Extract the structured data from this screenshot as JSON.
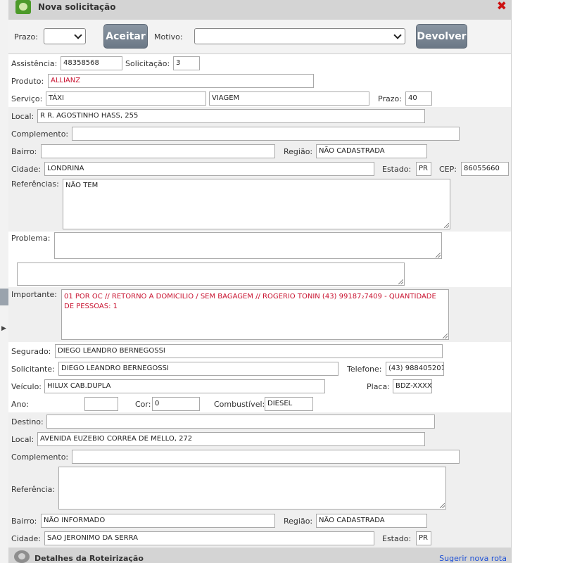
{
  "window": {
    "title": "Nova solicitação"
  },
  "toolbar": {
    "prazo_label": "Prazo:",
    "prazo_value": "",
    "accept_label": "Aceitar",
    "motivo_label": "Motivo:",
    "motivo_value": "",
    "return_label": "Devolver"
  },
  "form": {
    "assistencia_label": "Assistência:",
    "assistencia_value": "48358568",
    "solicitacao_label": "Solicitação:",
    "solicitacao_value": "3",
    "produto_label": "Produto:",
    "produto_value": "ALLIANZ",
    "servico_label": "Serviço:",
    "servico_value": "TÁXI",
    "servico_tipo_value": "VIAGEM",
    "prazo_label": "Prazo:",
    "prazo_value": "40",
    "local_label": "Local:",
    "local_value": "R R. AGOSTINHO HASS, 255",
    "complemento_label": "Complemento:",
    "complemento_value": "",
    "bairro_label": "Bairro:",
    "bairro_value": "",
    "regiao_label": "Região:",
    "regiao_value": "NÃO CADASTRADA",
    "cidade_label": "Cidade:",
    "cidade_value": "LONDRINA",
    "estado_label": "Estado:",
    "estado_value": "PR",
    "cep_label": "CEP:",
    "cep_value": "86055660",
    "referencias_label": "Referências:",
    "referencias_value": "NÃO TEM",
    "problema_label": "Problema:",
    "problema_value": "",
    "problema_extra_value": "",
    "importante_label": "Importante:",
    "importante_value": "01 POR OC // RETORNO A DOMICILIO  / SEM BAGAGEM //  ROGERIO TONIN (43) 99187₂7409 - QUANTIDADE DE PESSOAS: 1",
    "segurado_label": "Segurado:",
    "segurado_value": "DIEGO LEANDRO BERNEGOSSI",
    "solicitante_label": "Solicitante:",
    "solicitante_value": "DIEGO LEANDRO BERNEGOSSI",
    "telefone_label": "Telefone:",
    "telefone_value": "(43) 988405201",
    "veiculo_label": "Veículo:",
    "veiculo_value": "HILUX CAB.DUPLA",
    "placa_label": "Placa:",
    "placa_value": "BDZ-XXXX",
    "ano_label": "Ano:",
    "ano_value": "",
    "cor_label": "Cor:",
    "cor_value": "0",
    "combustivel_label": "Combustível:",
    "combustivel_value": "DIESEL"
  },
  "destino": {
    "destino_label": "Destino:",
    "destino_value": "",
    "local_label": "Local:",
    "local_value": "AVENIDA EUZEBIO CORREA DE MELLO, 272",
    "complemento_label": "Complemento:",
    "complemento_value": "",
    "referencia_label": "Referência:",
    "referencia_value": "",
    "bairro_label": "Bairro:",
    "bairro_value": "NÃO INFORMADO",
    "regiao_label": "Região:",
    "regiao_value": "NÃO CADASTRADA",
    "cidade_label": "Cidade:",
    "cidade_value": "SAO JERONIMO DA SERRA",
    "estado_label": "Estado:",
    "estado_value": "PR"
  },
  "footer": {
    "title": "Detalhes da Roteirização",
    "link": "Sugerir nova rota"
  },
  "colors": {
    "title_bar": "#d4d4d4",
    "button": "#7a8794",
    "highlight_text": "#c8102e",
    "link": "#1c4fd6",
    "close": "#cc1010"
  },
  "icons": {
    "app": "map-globe-icon",
    "close": "close-x-icon",
    "footer": "map-globe-icon"
  }
}
